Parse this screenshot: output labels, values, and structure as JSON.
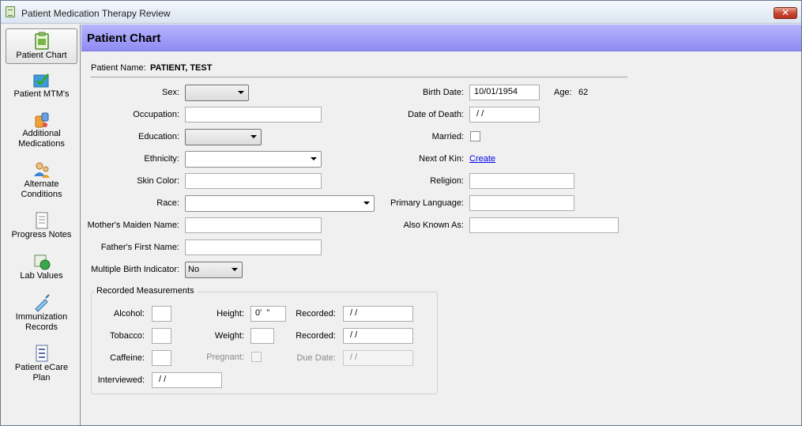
{
  "window": {
    "title": "Patient Medication Therapy Review",
    "close_label": "✕"
  },
  "sidebar": {
    "items": [
      {
        "label_lines": [
          "Patient Chart"
        ],
        "icon": "clipboard-icon"
      },
      {
        "label_lines": [
          "Patient MTM's"
        ],
        "icon": "checklist-icon"
      },
      {
        "label_lines": [
          "Additional",
          "Medications"
        ],
        "icon": "medications-icon"
      },
      {
        "label_lines": [
          "Alternate",
          "Conditions"
        ],
        "icon": "people-icon"
      },
      {
        "label_lines": [
          "Progress Notes"
        ],
        "icon": "document-icon"
      },
      {
        "label_lines": [
          "Lab Values"
        ],
        "icon": "lab-flask-icon"
      },
      {
        "label_lines": [
          "Immunization",
          "Records"
        ],
        "icon": "syringe-icon"
      },
      {
        "label_lines": [
          "Patient eCare",
          "Plan"
        ],
        "icon": "care-plan-icon"
      }
    ],
    "active_index": 0
  },
  "header": {
    "title": "Patient Chart"
  },
  "patient": {
    "name_label": "Patient Name:",
    "name_value": "PATIENT, TEST"
  },
  "left_form": {
    "sex": {
      "label": "Sex:",
      "value": ""
    },
    "occupation": {
      "label": "Occupation:",
      "value": ""
    },
    "education": {
      "label": "Education:",
      "value": ""
    },
    "ethnicity": {
      "label": "Ethnicity:",
      "value": ""
    },
    "skin_color": {
      "label": "Skin Color:",
      "value": ""
    },
    "race": {
      "label": "Race:",
      "value": ""
    },
    "mothers_maiden_name": {
      "label": "Mother's Maiden Name:",
      "value": ""
    },
    "fathers_first_name": {
      "label": "Father's First Name:",
      "value": ""
    },
    "multiple_birth": {
      "label": "Multiple Birth Indicator:",
      "value": "No"
    }
  },
  "right_form": {
    "birth_date": {
      "label": "Birth Date:",
      "value": "10/01/1954"
    },
    "age": {
      "label": "Age:",
      "value": "62"
    },
    "date_of_death": {
      "label": "Date of Death:",
      "value": " / /"
    },
    "married": {
      "label": "Married:",
      "checked": false
    },
    "next_of_kin": {
      "label": "Next of Kin:",
      "link": "Create"
    },
    "religion": {
      "label": "Religion:",
      "value": ""
    },
    "primary_language": {
      "label": "Primary Language:",
      "value": ""
    },
    "also_known_as": {
      "label": "Also Known As:",
      "value": ""
    }
  },
  "measurements": {
    "legend": "Recorded Measurements",
    "alcohol": {
      "label": "Alcohol:",
      "value": ""
    },
    "tobacco": {
      "label": "Tobacco:",
      "value": ""
    },
    "caffeine": {
      "label": "Caffeine:",
      "value": ""
    },
    "height": {
      "label": "Height:",
      "value": "0'  \""
    },
    "weight": {
      "label": "Weight:",
      "value": ""
    },
    "pregnant": {
      "label": "Pregnant:",
      "checked": false
    },
    "height_recorded": {
      "label": "Recorded:",
      "value": " / /"
    },
    "weight_recorded": {
      "label": "Recorded:",
      "value": " / /"
    },
    "due_date": {
      "label": "Due Date:",
      "value": " / /"
    },
    "interviewed": {
      "label": "Interviewed:",
      "value": " / /"
    }
  },
  "colors": {
    "header_band": "#9e9bf8",
    "link": "#0000ee",
    "close_button": "#c64530"
  }
}
